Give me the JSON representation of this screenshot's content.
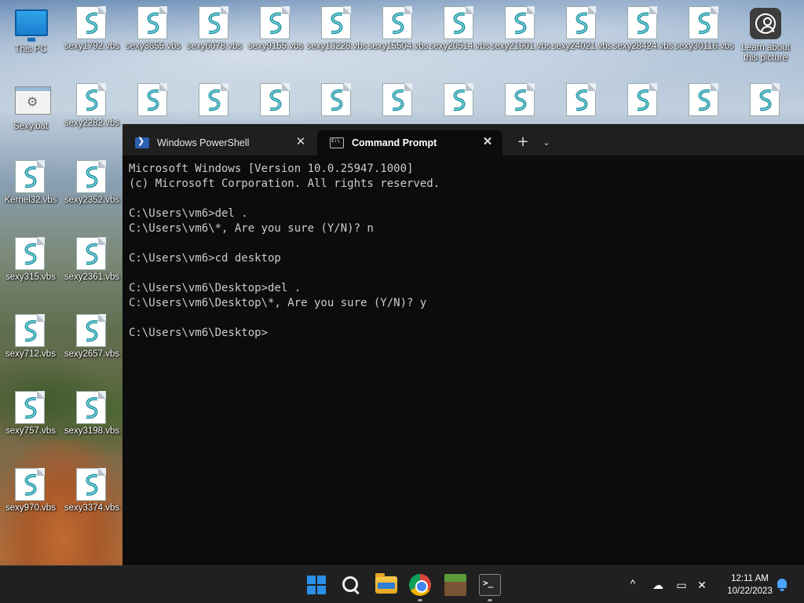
{
  "desktop": {
    "row1": [
      {
        "label": "This PC",
        "icon": "monitor-icon"
      },
      {
        "label": "sexy1792.vbs",
        "icon": "vbs-script-icon"
      },
      {
        "label": "sexy3655.vbs",
        "icon": "vbs-script-icon"
      },
      {
        "label": "sexy6078.vbs",
        "icon": "vbs-script-icon"
      },
      {
        "label": "sexy9155.vbs",
        "icon": "vbs-script-icon"
      },
      {
        "label": "sexy13228.vbs",
        "icon": "vbs-script-icon"
      },
      {
        "label": "sexy15504.vbs",
        "icon": "vbs-script-icon"
      },
      {
        "label": "sexy20514.vbs",
        "icon": "vbs-script-icon"
      },
      {
        "label": "sexy21901.vbs",
        "icon": "vbs-script-icon"
      },
      {
        "label": "sexy24021.vbs",
        "icon": "vbs-script-icon"
      },
      {
        "label": "sexy28424.vbs",
        "icon": "vbs-script-icon"
      },
      {
        "label": "sexy30116.vbs",
        "icon": "vbs-script-icon"
      },
      {
        "label": "Learn about this picture",
        "icon": "learn-picture-icon"
      }
    ],
    "row2": [
      {
        "label": "Sexy.bat",
        "icon": "batch-file-icon"
      },
      {
        "label": "sexy2282.vbs",
        "icon": "vbs-script-icon"
      },
      {
        "label": "",
        "icon": "vbs-script-icon"
      },
      {
        "label": "",
        "icon": "vbs-script-icon"
      },
      {
        "label": "",
        "icon": "vbs-script-icon"
      },
      {
        "label": "",
        "icon": "vbs-script-icon"
      },
      {
        "label": "",
        "icon": "vbs-script-icon"
      },
      {
        "label": "",
        "icon": "vbs-script-icon"
      },
      {
        "label": "",
        "icon": "vbs-script-icon"
      },
      {
        "label": "",
        "icon": "vbs-script-icon"
      },
      {
        "label": "",
        "icon": "vbs-script-icon"
      },
      {
        "label": "",
        "icon": "vbs-script-icon"
      },
      {
        "label": "",
        "icon": "vbs-script-icon"
      }
    ],
    "col1": [
      "Kernel32.vbs",
      "sexy315.vbs",
      "sexy712.vbs",
      "sexy757.vbs",
      "sexy970.vbs"
    ],
    "col2": [
      "sexy2352.vbs",
      "sexy2361.vbs",
      "sexy2657.vbs",
      "sexy3198.vbs",
      "sexy3374.vbs"
    ]
  },
  "terminal": {
    "tabs": [
      {
        "label": "Windows PowerShell",
        "icon": "powershell-icon",
        "active": false
      },
      {
        "label": "Command Prompt",
        "icon": "cmd-icon",
        "active": true
      }
    ],
    "close_glyph": "✕",
    "new_tab_glyph": "+",
    "dropdown_glyph": "⌄",
    "output": "Microsoft Windows [Version 10.0.25947.1000]\n(c) Microsoft Corporation. All rights reserved.\n\nC:\\Users\\vm6>del .\nC:\\Users\\vm6\\*, Are you sure (Y/N)? n\n\nC:\\Users\\vm6>cd desktop\n\nC:\\Users\\vm6\\Desktop>del .\nC:\\Users\\vm6\\Desktop\\*, Are you sure (Y/N)? y\n\nC:\\Users\\vm6\\Desktop>"
  },
  "taskbar": {
    "apps": [
      "start-icon",
      "search-icon",
      "file-explorer-icon",
      "chrome-icon",
      "minecraft-icon",
      "terminal-icon"
    ],
    "tray_chevron": "^",
    "time": "12:11 AM",
    "date": "10/22/2023"
  },
  "colors": {
    "terminal_bg": "#0c0c0c",
    "tabbar_bg": "#1f1f1f",
    "taskbar_bg": "#202020",
    "accent": "#2a8fe6"
  }
}
